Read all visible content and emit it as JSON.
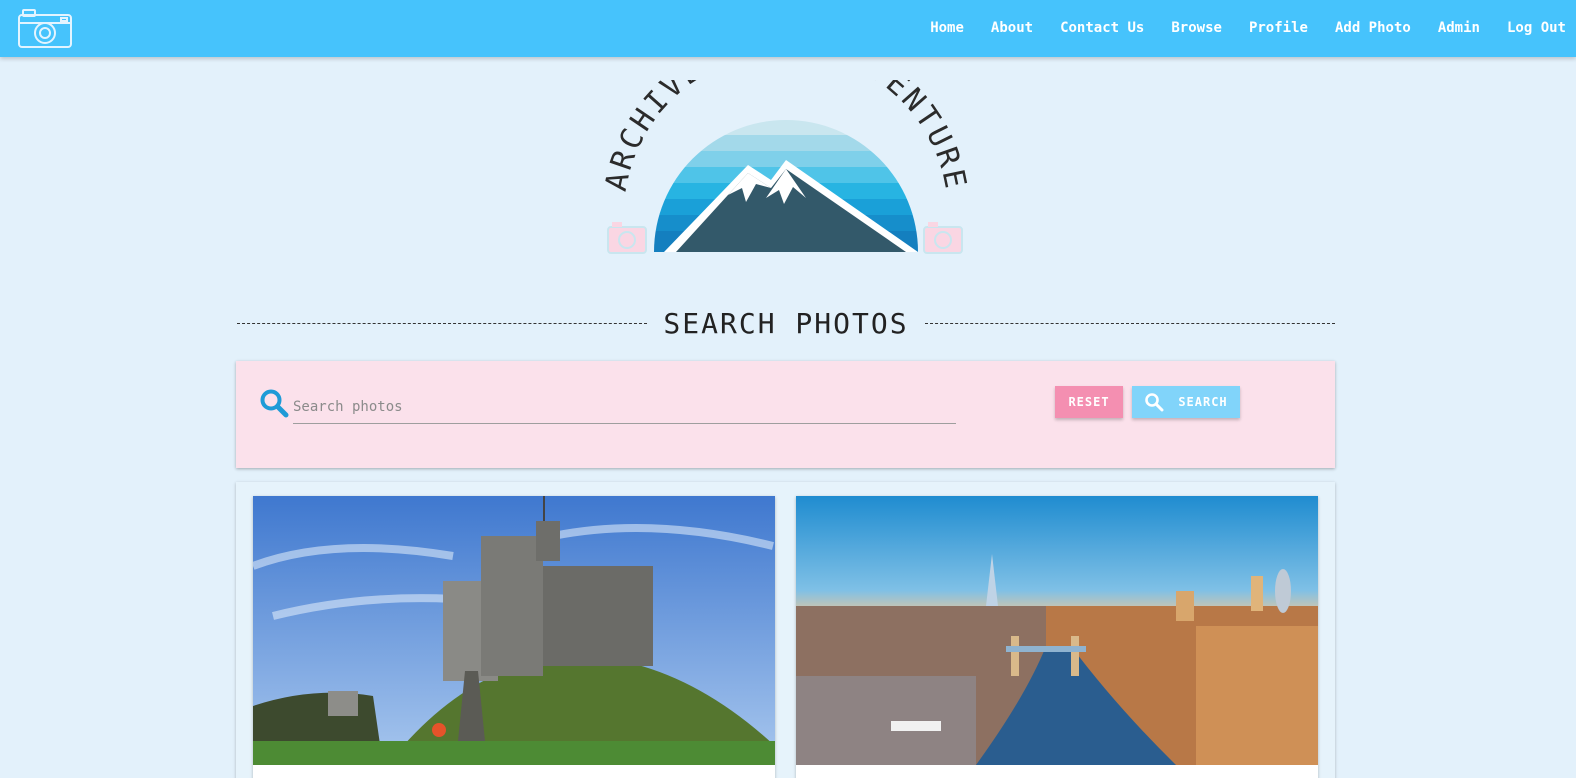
{
  "navbar": {
    "logo_icon": "camera-icon",
    "links": [
      "Home",
      "About",
      "Contact Us",
      "Browse",
      "Profile",
      "Add Photo",
      "Admin",
      "Log Out"
    ],
    "background": "#46c3fc"
  },
  "hero": {
    "logo_text": "ARCHIVE YOUR ADVENTURE",
    "icons": [
      "mountain-icon",
      "camera-icon"
    ]
  },
  "search": {
    "heading": "SEARCH PHOTOS",
    "placeholder": "Search photos",
    "value": "",
    "reset_label": "RESET",
    "search_label": "SEARCH",
    "colors": {
      "panel": "#fbe1eb",
      "reset": "#f48fb1",
      "search": "#81d4fa",
      "icon": "#1e9bd7"
    }
  },
  "results": {
    "photos": [
      {
        "subject": "castle-on-hill-photo"
      },
      {
        "subject": "city-river-bridge-photo"
      }
    ]
  }
}
